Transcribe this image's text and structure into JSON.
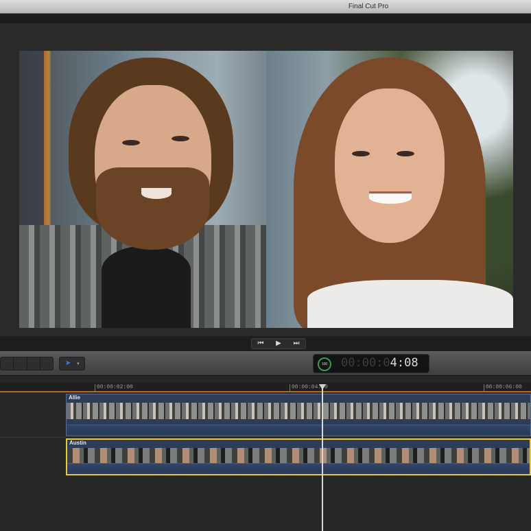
{
  "window": {
    "title": "Final Cut Pro"
  },
  "viewer": {
    "transport": {
      "prev_glyph": "⏮",
      "play_glyph": "▶",
      "next_glyph": "⏭"
    }
  },
  "toolbar": {
    "tool_glyph": "➤",
    "tool_caret": "▾",
    "dashboard": {
      "dial_label": "100",
      "timecode_dim": "00:00:0",
      "timecode_lit": "4:08"
    }
  },
  "timeline": {
    "ruler_ticks": [
      "00:00:02:00",
      "00:00:04:00",
      "00:00:06:00"
    ],
    "clips": [
      {
        "name": "Allie"
      },
      {
        "name": "Austin"
      }
    ]
  }
}
